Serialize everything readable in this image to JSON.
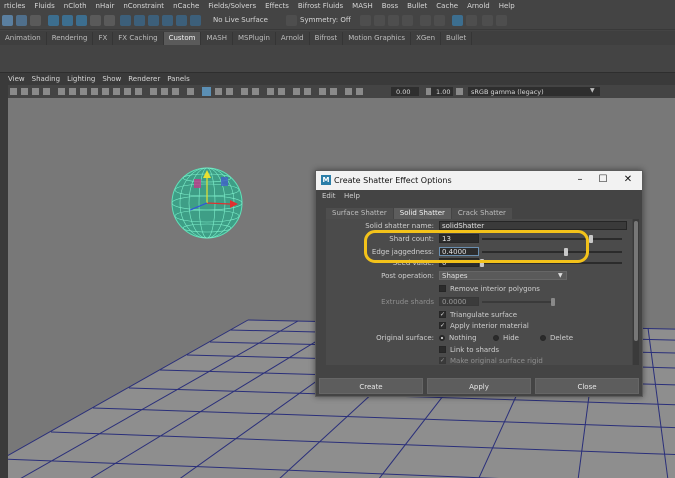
{
  "menubar": [
    "rticles",
    "Fluids",
    "nCloth",
    "nHair",
    "nConstraint",
    "nCache",
    "Fields/Solvers",
    "Effects",
    "Bifrost Fluids",
    "MASH",
    "Boss",
    "Bullet",
    "Cache",
    "Arnold",
    "Help"
  ],
  "toolbar": {
    "live_surface": "No Live Surface",
    "symmetry": "Symmetry: Off"
  },
  "shelf_tabs": [
    "Animation",
    "Rendering",
    "FX",
    "FX Caching",
    "Custom",
    "MASH",
    "MSPlugin",
    "Arnold",
    "Bifrost",
    "Motion Graphics",
    "XGen",
    "Bullet"
  ],
  "shelf_active": "Custom",
  "panel_menu": [
    "View",
    "Shading",
    "Lighting",
    "Show",
    "Renderer",
    "Panels"
  ],
  "panel_toolbar": {
    "value1": "0.00",
    "value2": "1.00",
    "colorspace": "sRGB gamma (legacy)"
  },
  "dialog": {
    "title": "Create Shatter Effect Options",
    "logo": "M",
    "menu": [
      "Edit",
      "Help"
    ],
    "tabs": [
      "Surface Shatter",
      "Solid Shatter",
      "Crack Shatter"
    ],
    "active_tab": "Solid Shatter",
    "solid_shatter_name_label": "Solid shatter name:",
    "solid_shatter_name": "solidShatter",
    "shard_count_label": "Shard count:",
    "shard_count": "13",
    "shard_count_slider": 0.78,
    "edge_jaggedness_label": "Edge jaggedness:",
    "edge_jaggedness": "0.4000",
    "edge_jaggedness_slider": 0.6,
    "seed_value_label": "Seed value:",
    "seed_value": "0",
    "seed_value_slider": 0.0,
    "post_operation_label": "Post operation:",
    "post_operation": "Shapes",
    "remove_interior_label": "Remove interior polygons",
    "extrude_shards_label": "Extrude shards",
    "extrude_shards": "0.0000",
    "triangulate_label": "Triangulate surface",
    "apply_interior_label": "Apply interior material",
    "original_surface_label": "Original surface:",
    "original_surface_options": [
      "Nothing",
      "Hide",
      "Delete"
    ],
    "original_surface_selected": "Nothing",
    "link_to_shards_label": "Link to shards",
    "make_rigid_label": "Make original surface rigid",
    "buttons": {
      "create": "Create",
      "apply": "Apply",
      "close": "Close"
    }
  },
  "colors": {
    "highlight": "#f3c21a",
    "sphere": "#5fe0b8",
    "grid_line": "#2a2f7a"
  }
}
